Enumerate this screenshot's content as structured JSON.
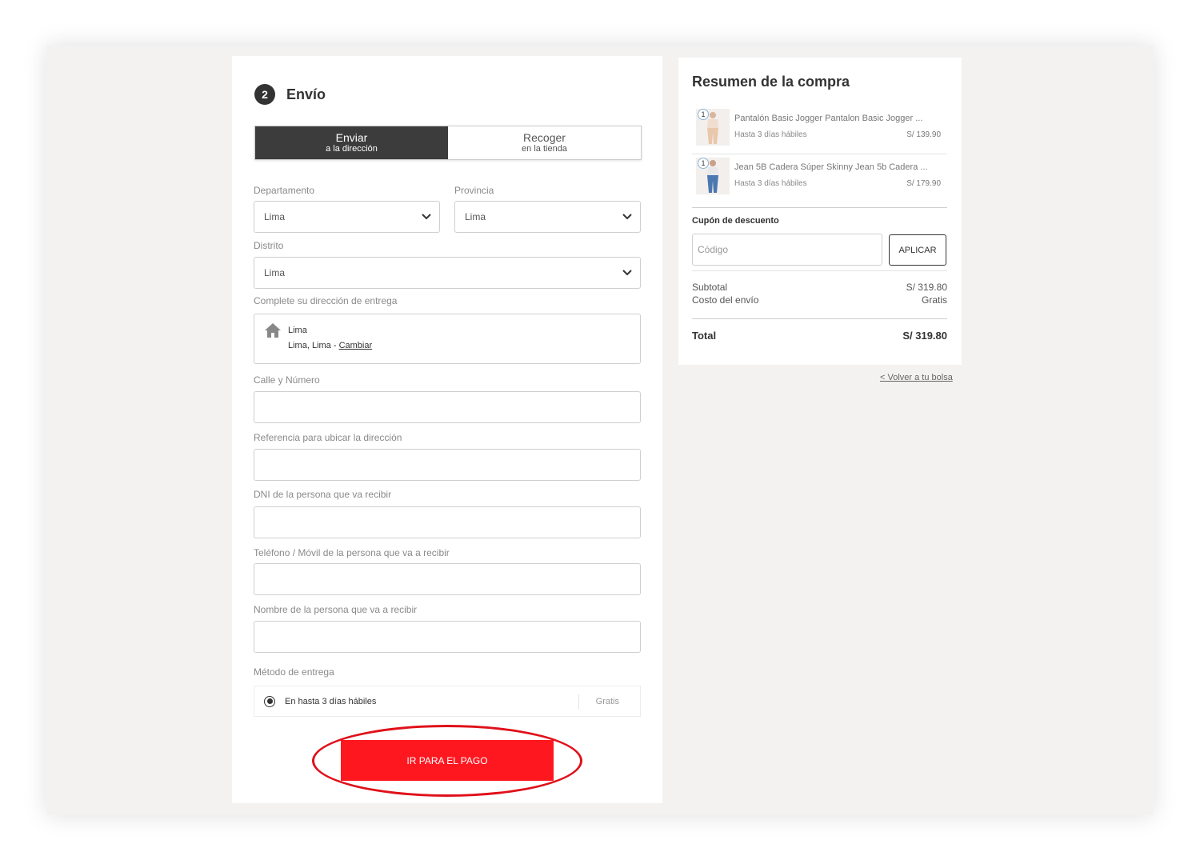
{
  "shipping": {
    "step_number": "2",
    "title": "Envío",
    "toggle": {
      "send_main": "Enviar",
      "send_sub": "a la dirección",
      "pickup_main": "Recoger",
      "pickup_sub": "en la tienda"
    },
    "department": {
      "label": "Departamento",
      "value": "Lima"
    },
    "province": {
      "label": "Provincia",
      "value": "Lima"
    },
    "district": {
      "label": "Distrito",
      "value": "Lima"
    },
    "address": {
      "label": "Complete su dirección de entrega",
      "line1": "Lima",
      "line2": "Lima, Lima - ",
      "change_link": "Cambiar"
    },
    "street_label": "Calle y Número",
    "reference_label": "Referencia para ubicar la dirección",
    "dni_label": "DNI de la persona que va recibir",
    "phone_label": "Teléfono / Móvil de la persona que va a recibir",
    "name_label": "Nombre de la persona que va a recibir",
    "delivery_method": {
      "label": "Método de entrega",
      "option": "En hasta 3 días hábiles",
      "price": "Gratis"
    },
    "pay_button": "IR PARA EL PAGO"
  },
  "summary": {
    "title": "Resumen de la compra",
    "items": [
      {
        "qty": "1",
        "name": "Pantalón Basic Jogger Pantalon Basic Jogger ...",
        "delivery": "Hasta 3 días hábiles",
        "price": "S/ 139.90"
      },
      {
        "qty": "1",
        "name": "Jean 5B Cadera Súper Skinny Jean 5b Cadera ...",
        "delivery": "Hasta 3 días hábiles",
        "price": "S/ 179.90"
      }
    ],
    "coupon": {
      "label": "Cupón de descuento",
      "placeholder": "Código",
      "button": "APLICAR"
    },
    "subtotal_label": "Subtotal",
    "subtotal_value": "S/ 319.80",
    "shipping_label": "Costo del envío",
    "shipping_value": "Gratis",
    "total_label": "Total",
    "total_value": "S/ 319.80",
    "back_link": "< Volver a tu bolsa"
  },
  "colors": {
    "accent": "#ff1720",
    "dark": "#3c3c3c",
    "background": "#f4f1f1"
  }
}
